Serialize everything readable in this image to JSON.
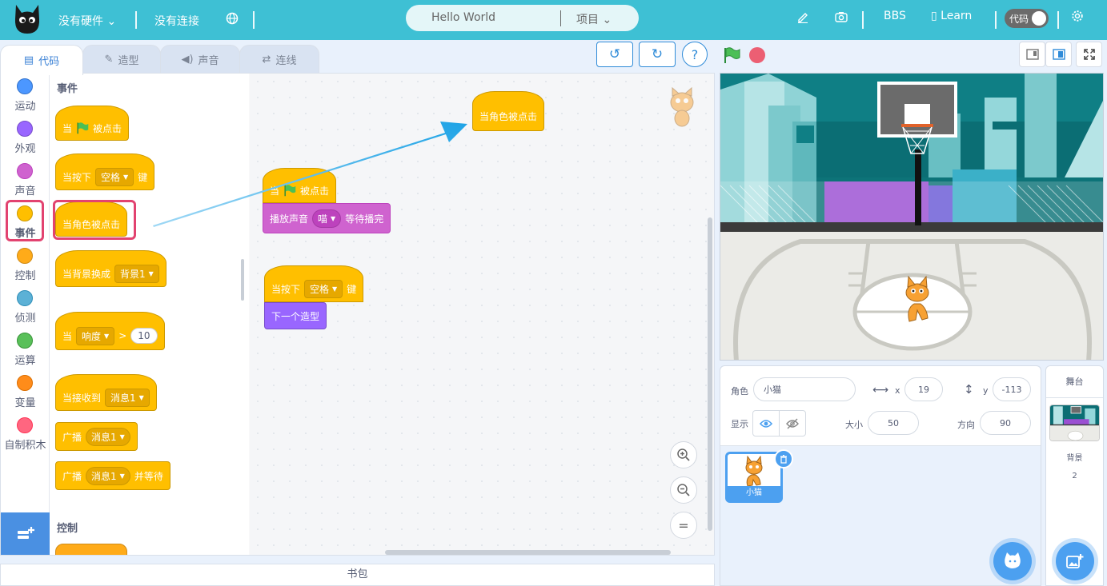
{
  "topbar": {
    "hardware_menu": "没有硬件",
    "connection": "没有连接",
    "project_title": "Hello World",
    "project_menu": "项目",
    "bbs": "BBS",
    "learn": "Learn",
    "mode_toggle": "代码"
  },
  "tabs": [
    {
      "label": "代码",
      "icon": "code-icon",
      "active": true
    },
    {
      "label": "造型",
      "icon": "brush-icon",
      "active": false
    },
    {
      "label": "声音",
      "icon": "speaker-icon",
      "active": false
    },
    {
      "label": "连线",
      "icon": "wire-icon",
      "active": false
    }
  ],
  "categories": [
    {
      "label": "运动",
      "color": "#4c97ff"
    },
    {
      "label": "外观",
      "color": "#9966ff"
    },
    {
      "label": "声音",
      "color": "#cf63cf"
    },
    {
      "label": "事件",
      "color": "#ffbf00"
    },
    {
      "label": "控制",
      "color": "#ffab19"
    },
    {
      "label": "侦测",
      "color": "#5cb1d6"
    },
    {
      "label": "运算",
      "color": "#59c059"
    },
    {
      "label": "变量",
      "color": "#ff8c1a"
    },
    {
      "label": "自制积木",
      "color": "#ff6680"
    }
  ],
  "palette": {
    "section_events": "事件",
    "section_control": "控制",
    "blocks": {
      "when_flag_pre": "当",
      "when_flag_post": "被点击",
      "when_key_pre": "当按下",
      "when_key_dd": "空格",
      "when_key_post": "键",
      "when_sprite_clicked": "当角色被点击",
      "when_backdrop_pre": "当背景换成",
      "when_backdrop_dd": "背景1",
      "when_greater_pre": "当",
      "when_greater_dd": "响度",
      "when_greater_op": ">",
      "when_greater_val": "10",
      "when_receive_pre": "当接收到",
      "when_receive_dd": "消息1",
      "broadcast_pre": "广播",
      "broadcast_dd": "消息1",
      "broadcast_wait_pre": "广播",
      "broadcast_wait_dd": "消息1",
      "broadcast_wait_post": "并等待"
    }
  },
  "workspace": {
    "hat_sprite_clicked": "当角色被点击",
    "script1_hat_pre": "当",
    "script1_hat_post": "被点击",
    "script1_sound_pre": "播放声音",
    "script1_sound_dd": "喵",
    "script1_sound_post": "等待播完",
    "script2_hat_pre": "当按下",
    "script2_hat_dd": "空格",
    "script2_hat_post": "键",
    "script2_looks": "下一个造型",
    "zoom_reset": "="
  },
  "backpack": "书包",
  "sprite_info": {
    "sprite_label": "角色",
    "sprite_name": "小猫",
    "x_label": "x",
    "x_value": "19",
    "y_label": "y",
    "y_value": "-113",
    "show_label": "显示",
    "size_label": "大小",
    "size_value": "50",
    "direction_label": "方向",
    "direction_value": "90"
  },
  "sprite_list": [
    {
      "name": "小猫"
    }
  ],
  "stage_panel": {
    "title": "舞台",
    "backdrop_label": "背景",
    "backdrop_count": "2"
  },
  "colors": {
    "topbar": "#3ec0d4",
    "events": "#ffbf00",
    "sound": "#cf63cf",
    "looks": "#9966ff",
    "highlight": "#e24370",
    "accent": "#4ca0f0"
  }
}
